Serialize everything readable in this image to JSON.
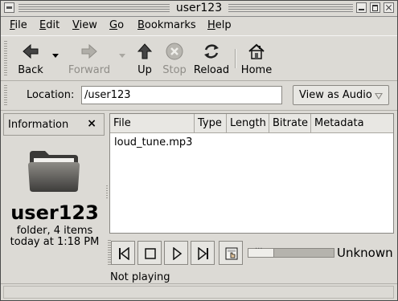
{
  "window": {
    "title": "user123"
  },
  "menu": {
    "file": "ile",
    "file_u": "F",
    "edit": "dit",
    "edit_u": "E",
    "view": "iew",
    "view_u": "V",
    "go": "o",
    "go_u": "G",
    "bookmarks": "ookmarks",
    "bookmarks_u": "B",
    "help": "elp",
    "help_u": "H"
  },
  "toolbar": {
    "back": "Back",
    "forward": "Forward",
    "up": "Up",
    "stop": "Stop",
    "reload": "Reload",
    "home": "Home"
  },
  "location": {
    "label": "Location:",
    "value": "/user123",
    "view_as": "View as Audio"
  },
  "sidebar": {
    "header": "Information",
    "close": "×",
    "name": "user123",
    "summary": "folder, 4 items",
    "modified": "today at 1:18 PM"
  },
  "list": {
    "columns": [
      "File",
      "Type",
      "Length",
      "Bitrate",
      "Metadata"
    ],
    "rows": [
      {
        "file": "loud_tune.mp3"
      }
    ]
  },
  "player": {
    "volume_label": "Unknown",
    "volume_level": 0.25,
    "status": "Not playing"
  },
  "icons": {
    "back": "back-arrow-icon",
    "forward": "forward-arrow-icon",
    "up": "up-arrow-icon",
    "stop": "stop-icon",
    "reload": "reload-icon",
    "home": "home-icon",
    "folder": "folder-icon"
  }
}
